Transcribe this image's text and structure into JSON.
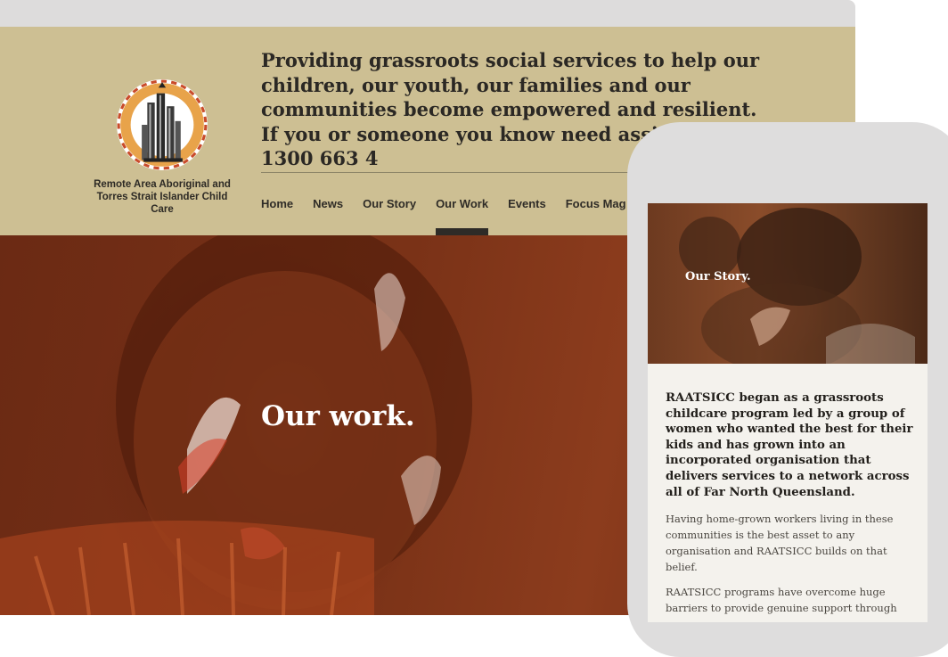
{
  "header": {
    "org_name": "Remote Area Aboriginal and Torres Strait Islander Child Care",
    "intro_text": "Providing grassroots social services to help our children, our youth, our families and our communities become empowered and resilient. If you or someone you know need assistance, call 1300 663 4"
  },
  "nav": {
    "items": [
      {
        "label": "Home"
      },
      {
        "label": "News"
      },
      {
        "label": "Our Story"
      },
      {
        "label": "Our Work",
        "active": true
      },
      {
        "label": "Events"
      },
      {
        "label": "Focus Mag"
      }
    ]
  },
  "hero": {
    "title": "Our work."
  },
  "mobile": {
    "hero_title": "Our Story.",
    "lead": "RAATSICC began as a grassroots childcare program led by a group of women who wanted the best for their kids and has grown into an incorporated organisation that delivers services to a network across all of Far North Queensland.",
    "paragraphs": [
      "Having home-grown workers living in these communities is the best asset to any organisation and RAATSICC builds on that belief.",
      "RAATSICC programs have overcome huge barriers to provide genuine support through"
    ]
  },
  "colors": {
    "header_bg": "#cdbf93",
    "hero_tint": "#7a3217",
    "text_dark": "#2b2824",
    "phone_frame": "#dedddd"
  }
}
